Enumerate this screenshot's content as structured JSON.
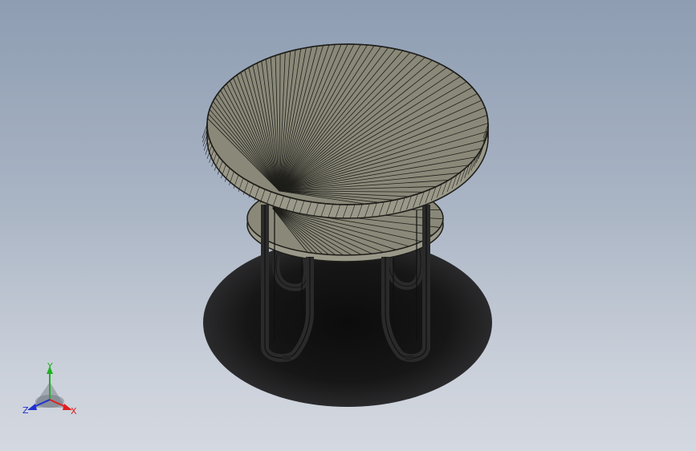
{
  "viewport": {
    "model": "round-side-table",
    "background_top": "#8e9db2",
    "background_bottom": "#d4d8e0"
  },
  "table": {
    "top_fill": "#8a8878",
    "edge_fill": "#9a9888",
    "line_color": "#1e1e1a",
    "shadow_color": "#141414"
  },
  "triad": {
    "x_label": "X",
    "y_label": "Y",
    "z_label": "Z",
    "x_color": "#e02020",
    "y_color": "#20b020",
    "z_color": "#2030d0"
  }
}
